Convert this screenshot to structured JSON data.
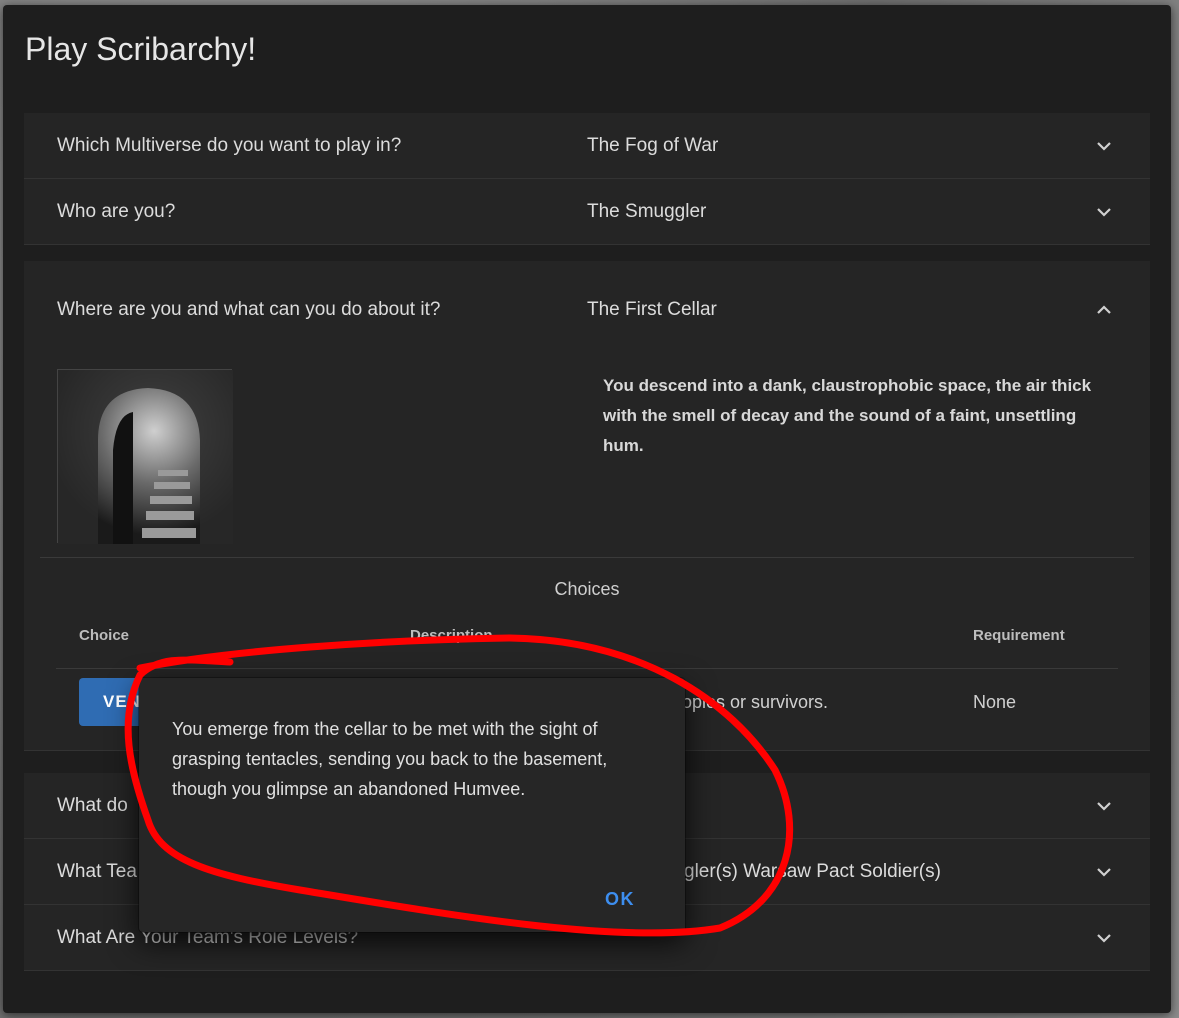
{
  "app": {
    "title": "Play Scribarchy!"
  },
  "panels": [
    {
      "question": "Which Multiverse do you want to play in?",
      "answer": "The Fog of War",
      "expanded": false
    },
    {
      "question": "Who are you?",
      "answer": "The Smuggler",
      "expanded": false
    },
    {
      "question": "Where are you and what can you do about it?",
      "answer": "The First Cellar",
      "expanded": true
    },
    {
      "question": "What do",
      "answer": "",
      "expanded": false
    },
    {
      "question": "What Tea",
      "answer": "gler(s) Warsaw Pact Soldier(s)",
      "expanded": false
    },
    {
      "question": "What Are Your Team's Role Levels?",
      "answer": "",
      "expanded": false
    }
  ],
  "location": {
    "description": "You descend into a dank, claustrophobic space, the air thick with the smell of decay and the sound of a faint, unsettling hum."
  },
  "choices": {
    "title": "Choices",
    "headers": {
      "choice": "Choice",
      "description": "Description",
      "requirement": "Requirement"
    },
    "rows": [
      {
        "button": "VEN",
        "description": "...opies or survivors.",
        "requirement": "None"
      }
    ]
  },
  "dialog": {
    "message": "You emerge from the cellar to be met with the sight of grasping tentacles, sending you back to the basement, though you glimpse an abandoned Humvee.",
    "ok_label": "OK"
  },
  "colors": {
    "accent": "#3d8eef",
    "button": "#2f6cb3",
    "annotation": "#ff0000"
  }
}
